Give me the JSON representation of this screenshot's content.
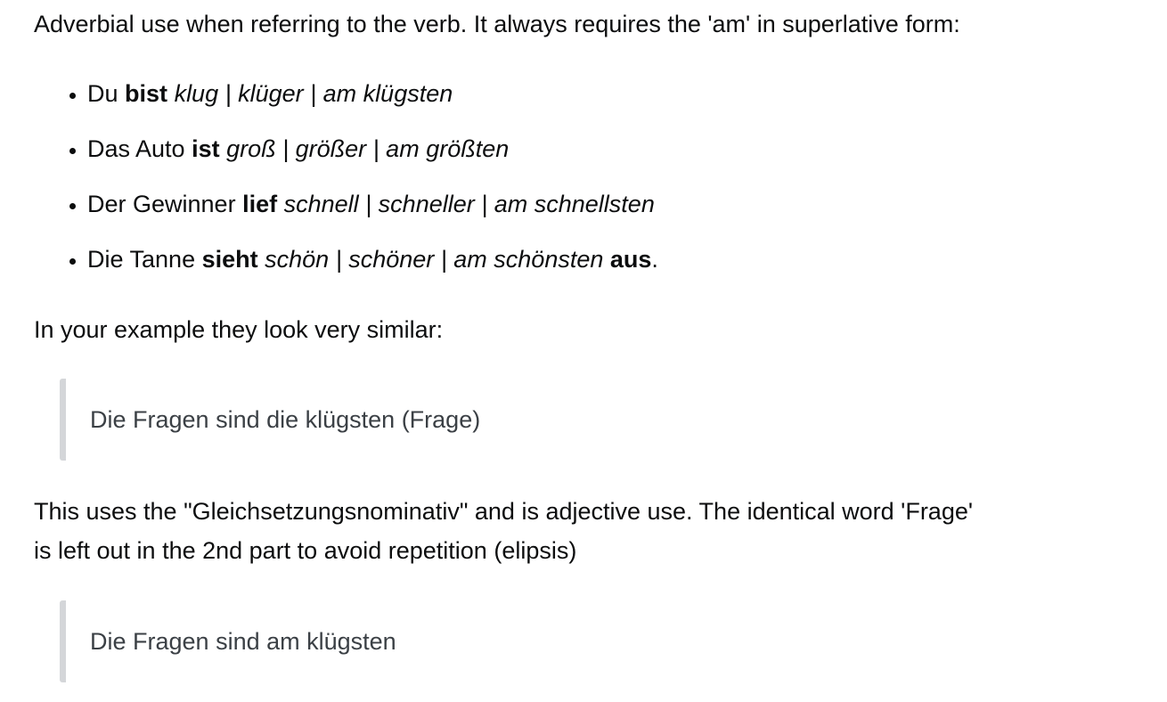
{
  "intro": "Adverbial use when referring to the verb. It always requires the 'am' in superlative form:",
  "examples": [
    {
      "pre": "Du ",
      "verb": "bist",
      "mid": " ",
      "forms": "klug | klüger | am klügsten",
      "post_bold": "",
      "end": ""
    },
    {
      "pre": "Das Auto ",
      "verb": "ist",
      "mid": " ",
      "forms": "groß | größer | am größten",
      "post_bold": "",
      "end": ""
    },
    {
      "pre": "Der Gewinner ",
      "verb": "lief",
      "mid": " ",
      "forms": "schnell | schneller | am schnellsten",
      "post_bold": "",
      "end": ""
    },
    {
      "pre": "Die Tanne ",
      "verb": "sieht",
      "mid": " ",
      "forms": "schön | schöner | am schönsten",
      "post_bold": "aus",
      "end": "."
    }
  ],
  "example_intro": "In your example they look very similar:",
  "quote1": "Die Fragen sind die klügsten (Frage)",
  "para3_line1": "This uses the \"Gleichsetzungsnominativ\" and is adjective use. The identical word 'Frage'",
  "para3_line2": "is left out in the 2nd part to avoid repetition (elipsis)",
  "quote2": "Die Fragen sind am klügsten"
}
